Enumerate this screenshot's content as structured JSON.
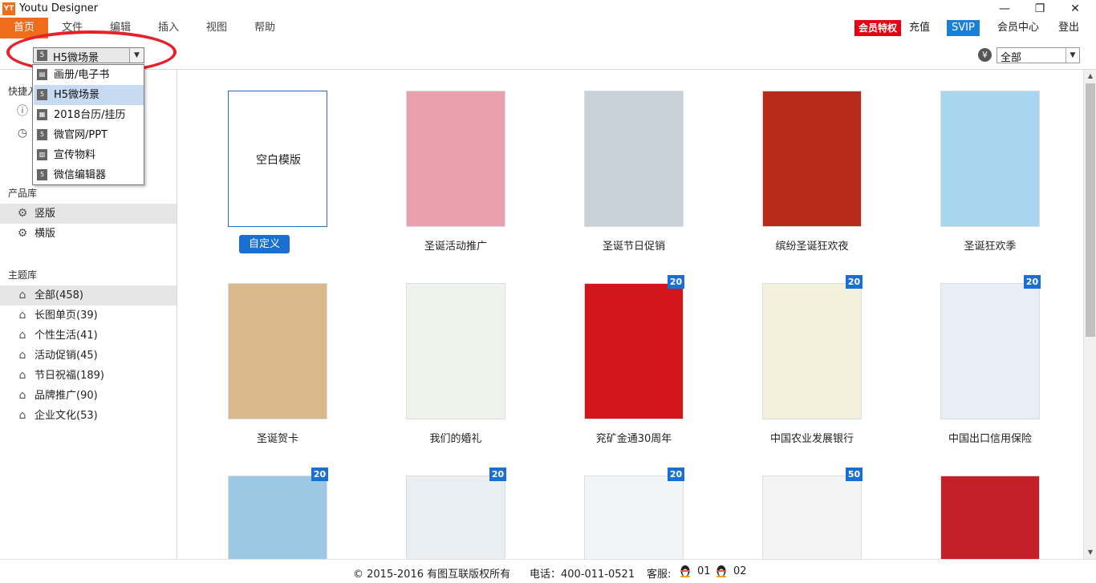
{
  "app": {
    "title": "Youtu Designer",
    "logo_text": "YT"
  },
  "window": {
    "minimize": "—",
    "restore": "❐",
    "close": "✕"
  },
  "menu": {
    "items": [
      "首页",
      "文件",
      "编辑",
      "插入",
      "视图",
      "帮助"
    ],
    "right": {
      "vip": "会员特权",
      "recharge": "充值",
      "svip": "SVIP",
      "member_center": "会员中心",
      "logout": "登出"
    }
  },
  "scene_select": {
    "value": "H5微场景",
    "arrow": "▼"
  },
  "price_select": {
    "value": "全部",
    "arrow": "▼",
    "currency_symbol": "¥"
  },
  "dropdown": {
    "items": [
      {
        "label": "画册/电子书",
        "icon": "book-icon"
      },
      {
        "label": "H5微场景",
        "icon": "html5-icon",
        "selected": true
      },
      {
        "label": "2018台历/挂历",
        "icon": "calendar-icon"
      },
      {
        "label": "微官网/PPT",
        "icon": "html5-icon"
      },
      {
        "label": "宣传物料",
        "icon": "flyer-icon"
      },
      {
        "label": "微信编辑器",
        "icon": "html5-icon"
      }
    ]
  },
  "sidebar": {
    "quick_heading": "快捷入口",
    "quick_items": [
      {
        "label": "",
        "icon": "info-icon"
      },
      {
        "label": "",
        "icon": "clock-icon"
      }
    ],
    "product_heading": "产品库",
    "product_items": [
      {
        "label": "竖版",
        "icon": "gear-icon",
        "active": true
      },
      {
        "label": "横版",
        "icon": "gear-icon"
      }
    ],
    "theme_heading": "主题库",
    "theme_items": [
      {
        "label": "全部(458)",
        "active": true
      },
      {
        "label": "长图单页(39)"
      },
      {
        "label": "个性生活(41)"
      },
      {
        "label": "活动促销(45)"
      },
      {
        "label": "节日祝福(189)"
      },
      {
        "label": "品牌推广(90)"
      },
      {
        "label": "企业文化(53)"
      }
    ]
  },
  "blank_template": {
    "text": "空白模版",
    "button": "自定义"
  },
  "templates": [
    {
      "label": "圣诞活动推广",
      "badge": "",
      "bg": "#e8a0ad"
    },
    {
      "label": "圣诞节日促销",
      "badge": "",
      "bg": "#c8d2d8"
    },
    {
      "label": "缤纷圣诞狂欢夜",
      "badge": "",
      "bg": "#b82a1a"
    },
    {
      "label": "圣诞狂欢季",
      "badge": "",
      "bg": "#a9d6ef"
    },
    {
      "label": "圣诞贺卡",
      "badge": "",
      "bg": "#d9b88c"
    },
    {
      "label": "我们的婚礼",
      "badge": "",
      "bg": "#eef4ec"
    },
    {
      "label": "兖矿金通30周年",
      "badge": "20",
      "bg": "#d4161a"
    },
    {
      "label": "中国农业发展银行",
      "badge": "20",
      "bg": "#f3f0dc"
    },
    {
      "label": "中国出口信用保险",
      "badge": "20",
      "bg": "#e8eef6"
    },
    {
      "label": "",
      "badge": "20",
      "bg": "#9cc8e4"
    },
    {
      "label": "",
      "badge": "20",
      "bg": "#e9eef2"
    },
    {
      "label": "",
      "badge": "20",
      "bg": "#f2f5f8"
    },
    {
      "label": "",
      "badge": "50",
      "bg": "#f4f4f4"
    },
    {
      "label": "",
      "badge": "",
      "bg": "#c4202a"
    }
  ],
  "footer": {
    "copyright": "© 2015-2016 有图互联版权所有",
    "phone": "电话：400-011-0521",
    "service": "客服:",
    "qq1": "01",
    "qq2": "02"
  }
}
